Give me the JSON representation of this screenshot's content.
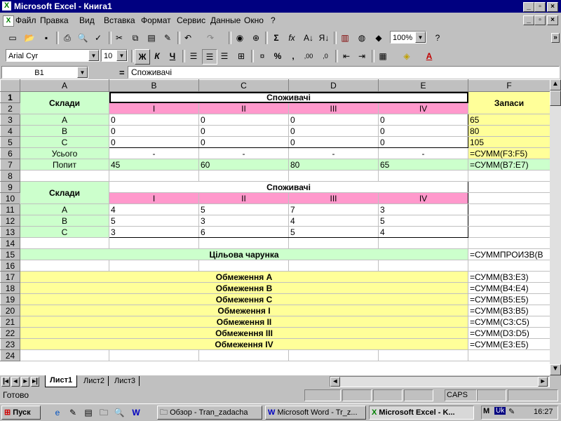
{
  "window": {
    "title": "Microsoft Excel - Книга1",
    "app_icon": "excel-icon"
  },
  "menu": [
    "Файл",
    "Правка",
    "Вид",
    "Вставка",
    "Формат",
    "Сервис",
    "Данные",
    "Окно",
    "?"
  ],
  "toolbar": {
    "zoom": "100%",
    "font_name": "Arial Cyr",
    "font_size": "10",
    "bold": "Ж",
    "italic": "К",
    "underline": "Ч",
    "sum": "Σ",
    "fx": "fx",
    "percent": "%",
    "comma": ",",
    "inc_decimal": ",00",
    "dec_decimal": ",0"
  },
  "formula_bar": {
    "name_box": "B1",
    "equals": "=",
    "content": "Споживачі"
  },
  "columns": [
    "A",
    "B",
    "C",
    "D",
    "E",
    "F"
  ],
  "cells": {
    "r1": {
      "A": "Склади",
      "B": "Споживачі",
      "F": "Запаси"
    },
    "r2": {
      "B": "I",
      "C": "II",
      "D": "III",
      "E": "IV"
    },
    "r3": {
      "A": "A",
      "B": "0",
      "C": "0",
      "D": "0",
      "E": "0",
      "F": "65"
    },
    "r4": {
      "A": "B",
      "B": "0",
      "C": "0",
      "D": "0",
      "E": "0",
      "F": "80"
    },
    "r5": {
      "A": "C",
      "B": "0",
      "C": "0",
      "D": "0",
      "E": "0",
      "F": "105"
    },
    "r6": {
      "A": "Усього",
      "B": "-",
      "C": "-",
      "D": "-",
      "E": "-",
      "F": "=СУММ(F3:F5)"
    },
    "r7": {
      "A": "Попит",
      "B": "45",
      "C": "60",
      "D": "80",
      "E": "65",
      "F": "=СУММ(B7:E7)"
    },
    "r9": {
      "A": "Склади",
      "B": "Споживачі"
    },
    "r10": {
      "B": "I",
      "C": "II",
      "D": "III",
      "E": "IV"
    },
    "r11": {
      "A": "A",
      "B": "4",
      "C": "5",
      "D": "7",
      "E": "3"
    },
    "r12": {
      "A": "B",
      "B": "5",
      "C": "3",
      "D": "4",
      "E": "5"
    },
    "r13": {
      "A": "C",
      "B": "3",
      "C": "6",
      "D": "5",
      "E": "4"
    },
    "r15": {
      "A": "Цільова чарунка",
      "F": "=СУММПРОИЗВ(B"
    },
    "r17": {
      "A": "Обмеження A",
      "F": "=СУММ(B3:E3)"
    },
    "r18": {
      "A": "Обмеження B",
      "F": "=СУММ(B4:E4)"
    },
    "r19": {
      "A": "Обмеження C",
      "F": "=СУММ(B5:E5)"
    },
    "r20": {
      "A": "Обмеження I",
      "F": "=СУММ(B3:B5)"
    },
    "r21": {
      "A": "Обмеження II",
      "F": "=СУММ(C3:C5)"
    },
    "r22": {
      "A": "Обмеження III",
      "F": "=СУММ(D3:D5)"
    },
    "r23": {
      "A": "Обмеження IV",
      "F": "=СУММ(E3:E5)"
    }
  },
  "row_numbers": [
    "1",
    "2",
    "3",
    "4",
    "5",
    "6",
    "7",
    "8",
    "9",
    "10",
    "11",
    "12",
    "13",
    "14",
    "15",
    "16",
    "17",
    "18",
    "19",
    "20",
    "21",
    "22",
    "23",
    "24"
  ],
  "sheet_tabs": [
    "Лист1",
    "Лист2",
    "Лист3"
  ],
  "status": {
    "ready": "Готово",
    "caps": "CAPS"
  },
  "taskbar": {
    "start": "Пуск",
    "tasks": [
      "Обзор - Tran_zadacha",
      "Microsoft Word - Tr_z...",
      "Microsoft Excel - K..."
    ],
    "lang": "Uk",
    "clock": "16:27"
  },
  "colors": {
    "title_bar": "#000080",
    "header_green": "#ccffcc",
    "header_pink": "#ff99cc",
    "formula_yellow": "#ffff99"
  }
}
